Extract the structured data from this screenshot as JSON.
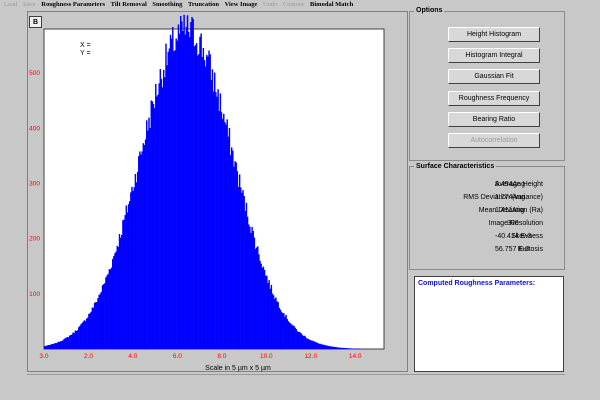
{
  "menu": [
    {
      "label": "Load",
      "enabled": false
    },
    {
      "label": "Save",
      "enabled": false
    },
    {
      "label": "Roughness Parameters",
      "enabled": true
    },
    {
      "label": "Tilt Removal",
      "enabled": true
    },
    {
      "label": "Smoothing",
      "enabled": true
    },
    {
      "label": "Truncation",
      "enabled": true
    },
    {
      "label": "View Image",
      "enabled": true
    },
    {
      "label": "Undo",
      "enabled": false
    },
    {
      "label": "Contour",
      "enabled": false
    },
    {
      "label": "Bimodal Match",
      "enabled": true
    }
  ],
  "chart_toolbar": {
    "b_label": "B"
  },
  "cursor": {
    "x_label": "X =",
    "y_label": "Y ="
  },
  "chart_data": {
    "type": "bar",
    "title": "",
    "xlabel": "Scale in 5 µm x 5 µm",
    "ylabel": "",
    "xlim": [
      3.0,
      16.0
    ],
    "ylim": [
      0,
      580
    ],
    "xticks": [
      "3.0",
      "2.0",
      "4.0",
      "6.0",
      "8.0",
      "10.0",
      "12.0",
      "14.0"
    ],
    "yticks": [
      "100",
      "200",
      "300",
      "400",
      "500"
    ],
    "bar_color": "#0000ff",
    "distribution": {
      "mean": 8.454,
      "rms": 1.774,
      "peak_count": 578,
      "bins": 300,
      "skewness": -0.040414,
      "kurtosis": 0.056757
    }
  },
  "options": {
    "title": "Options",
    "buttons": [
      {
        "label": "Height Histogram",
        "enabled": true
      },
      {
        "label": "Histogram Integral",
        "enabled": true
      },
      {
        "label": "Gaussian Fit",
        "enabled": true
      },
      {
        "label": "Roughness Frequency",
        "enabled": true
      },
      {
        "label": "Bearing Ratio",
        "enabled": true
      },
      {
        "label": "Autocorrelation",
        "enabled": false
      }
    ]
  },
  "surface": {
    "title": "Surface Characteristics",
    "rows": [
      {
        "label": "Average Height",
        "value": "8.454Ang"
      },
      {
        "label": "RMS Deviation (variance)",
        "value": "1.774Ang"
      },
      {
        "label": "Mean Deviation (Ra)",
        "value": "1.411Ang"
      },
      {
        "label": "Image Resolution",
        "value": "300"
      },
      {
        "label": "Skewness",
        "value": "-40.414 E-3"
      },
      {
        "label": "Kurtosis",
        "value": "56.757 E-3"
      }
    ]
  },
  "computed": {
    "title": "Computed Roughness Parameters:"
  },
  "colors": {
    "accent": "#0000ff",
    "axis_label": "#ff0000",
    "panel": "#c8c8c8"
  }
}
